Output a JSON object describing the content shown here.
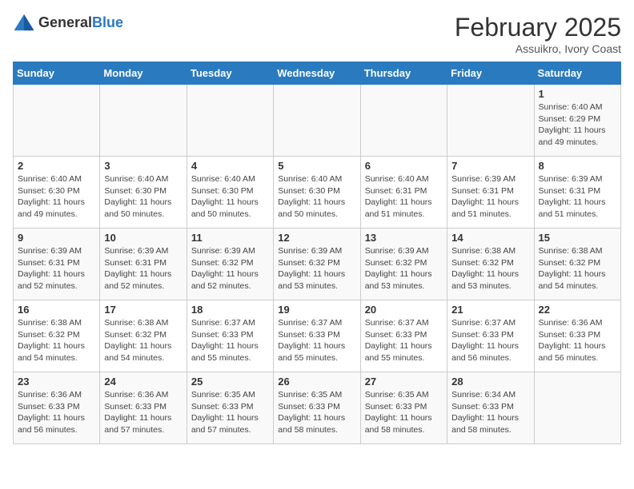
{
  "header": {
    "logo_general": "General",
    "logo_blue": "Blue",
    "title": "February 2025",
    "subtitle": "Assuikro, Ivory Coast"
  },
  "weekdays": [
    "Sunday",
    "Monday",
    "Tuesday",
    "Wednesday",
    "Thursday",
    "Friday",
    "Saturday"
  ],
  "weeks": [
    [
      {
        "day": "",
        "info": ""
      },
      {
        "day": "",
        "info": ""
      },
      {
        "day": "",
        "info": ""
      },
      {
        "day": "",
        "info": ""
      },
      {
        "day": "",
        "info": ""
      },
      {
        "day": "",
        "info": ""
      },
      {
        "day": "1",
        "info": "Sunrise: 6:40 AM\nSunset: 6:29 PM\nDaylight: 11 hours\nand 49 minutes."
      }
    ],
    [
      {
        "day": "2",
        "info": "Sunrise: 6:40 AM\nSunset: 6:30 PM\nDaylight: 11 hours\nand 49 minutes."
      },
      {
        "day": "3",
        "info": "Sunrise: 6:40 AM\nSunset: 6:30 PM\nDaylight: 11 hours\nand 50 minutes."
      },
      {
        "day": "4",
        "info": "Sunrise: 6:40 AM\nSunset: 6:30 PM\nDaylight: 11 hours\nand 50 minutes."
      },
      {
        "day": "5",
        "info": "Sunrise: 6:40 AM\nSunset: 6:30 PM\nDaylight: 11 hours\nand 50 minutes."
      },
      {
        "day": "6",
        "info": "Sunrise: 6:40 AM\nSunset: 6:31 PM\nDaylight: 11 hours\nand 51 minutes."
      },
      {
        "day": "7",
        "info": "Sunrise: 6:39 AM\nSunset: 6:31 PM\nDaylight: 11 hours\nand 51 minutes."
      },
      {
        "day": "8",
        "info": "Sunrise: 6:39 AM\nSunset: 6:31 PM\nDaylight: 11 hours\nand 51 minutes."
      }
    ],
    [
      {
        "day": "9",
        "info": "Sunrise: 6:39 AM\nSunset: 6:31 PM\nDaylight: 11 hours\nand 52 minutes."
      },
      {
        "day": "10",
        "info": "Sunrise: 6:39 AM\nSunset: 6:31 PM\nDaylight: 11 hours\nand 52 minutes."
      },
      {
        "day": "11",
        "info": "Sunrise: 6:39 AM\nSunset: 6:32 PM\nDaylight: 11 hours\nand 52 minutes."
      },
      {
        "day": "12",
        "info": "Sunrise: 6:39 AM\nSunset: 6:32 PM\nDaylight: 11 hours\nand 53 minutes."
      },
      {
        "day": "13",
        "info": "Sunrise: 6:39 AM\nSunset: 6:32 PM\nDaylight: 11 hours\nand 53 minutes."
      },
      {
        "day": "14",
        "info": "Sunrise: 6:38 AM\nSunset: 6:32 PM\nDaylight: 11 hours\nand 53 minutes."
      },
      {
        "day": "15",
        "info": "Sunrise: 6:38 AM\nSunset: 6:32 PM\nDaylight: 11 hours\nand 54 minutes."
      }
    ],
    [
      {
        "day": "16",
        "info": "Sunrise: 6:38 AM\nSunset: 6:32 PM\nDaylight: 11 hours\nand 54 minutes."
      },
      {
        "day": "17",
        "info": "Sunrise: 6:38 AM\nSunset: 6:32 PM\nDaylight: 11 hours\nand 54 minutes."
      },
      {
        "day": "18",
        "info": "Sunrise: 6:37 AM\nSunset: 6:33 PM\nDaylight: 11 hours\nand 55 minutes."
      },
      {
        "day": "19",
        "info": "Sunrise: 6:37 AM\nSunset: 6:33 PM\nDaylight: 11 hours\nand 55 minutes."
      },
      {
        "day": "20",
        "info": "Sunrise: 6:37 AM\nSunset: 6:33 PM\nDaylight: 11 hours\nand 55 minutes."
      },
      {
        "day": "21",
        "info": "Sunrise: 6:37 AM\nSunset: 6:33 PM\nDaylight: 11 hours\nand 56 minutes."
      },
      {
        "day": "22",
        "info": "Sunrise: 6:36 AM\nSunset: 6:33 PM\nDaylight: 11 hours\nand 56 minutes."
      }
    ],
    [
      {
        "day": "23",
        "info": "Sunrise: 6:36 AM\nSunset: 6:33 PM\nDaylight: 11 hours\nand 56 minutes."
      },
      {
        "day": "24",
        "info": "Sunrise: 6:36 AM\nSunset: 6:33 PM\nDaylight: 11 hours\nand 57 minutes."
      },
      {
        "day": "25",
        "info": "Sunrise: 6:35 AM\nSunset: 6:33 PM\nDaylight: 11 hours\nand 57 minutes."
      },
      {
        "day": "26",
        "info": "Sunrise: 6:35 AM\nSunset: 6:33 PM\nDaylight: 11 hours\nand 58 minutes."
      },
      {
        "day": "27",
        "info": "Sunrise: 6:35 AM\nSunset: 6:33 PM\nDaylight: 11 hours\nand 58 minutes."
      },
      {
        "day": "28",
        "info": "Sunrise: 6:34 AM\nSunset: 6:33 PM\nDaylight: 11 hours\nand 58 minutes."
      },
      {
        "day": "",
        "info": ""
      }
    ]
  ]
}
